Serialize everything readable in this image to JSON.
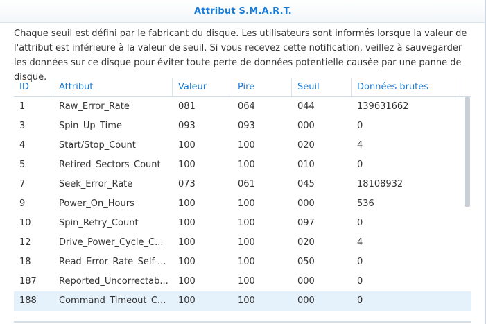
{
  "dialog": {
    "title": "Attribut S.M.A.R.T.",
    "description": "Chaque seuil est défini par le fabricant du disque. Les utilisateurs sont informés lorsque la valeur de l'attribut est inférieure à la valeur de seuil. Si vous recevez cette notification, veillez à sauvegarder les données sur ce disque pour éviter toute perte de données potentielle causée par une panne de disque."
  },
  "table": {
    "columns": [
      "ID",
      "Attribut",
      "Valeur",
      "Pire",
      "Seuil",
      "Données brutes"
    ],
    "rows": [
      {
        "id": "1",
        "attr": "Raw_Error_Rate",
        "value": "081",
        "worst": "064",
        "threshold": "044",
        "raw": "139631662"
      },
      {
        "id": "3",
        "attr": "Spin_Up_Time",
        "value": "093",
        "worst": "093",
        "threshold": "000",
        "raw": "0"
      },
      {
        "id": "4",
        "attr": "Start/Stop_Count",
        "value": "100",
        "worst": "100",
        "threshold": "020",
        "raw": "4"
      },
      {
        "id": "5",
        "attr": "Retired_Sectors_Count",
        "value": "100",
        "worst": "100",
        "threshold": "010",
        "raw": "0"
      },
      {
        "id": "7",
        "attr": "Seek_Error_Rate",
        "value": "073",
        "worst": "061",
        "threshold": "045",
        "raw": "18108932"
      },
      {
        "id": "9",
        "attr": "Power_On_Hours",
        "value": "100",
        "worst": "100",
        "threshold": "000",
        "raw": "536"
      },
      {
        "id": "10",
        "attr": "Spin_Retry_Count",
        "value": "100",
        "worst": "100",
        "threshold": "097",
        "raw": "0"
      },
      {
        "id": "12",
        "attr": "Drive_Power_Cycle_C...",
        "value": "100",
        "worst": "100",
        "threshold": "020",
        "raw": "4"
      },
      {
        "id": "18",
        "attr": "Read_Error_Rate_Self-...",
        "value": "100",
        "worst": "100",
        "threshold": "050",
        "raw": "0"
      },
      {
        "id": "187",
        "attr": "Reported_Uncorrectab...",
        "value": "100",
        "worst": "100",
        "threshold": "000",
        "raw": "0"
      },
      {
        "id": "188",
        "attr": "Command_Timeout_C...",
        "value": "100",
        "worst": "100",
        "threshold": "000",
        "raw": "0"
      }
    ]
  },
  "colors": {
    "accent": "#1a7bd5",
    "selected_row": "#e6f2fb"
  }
}
